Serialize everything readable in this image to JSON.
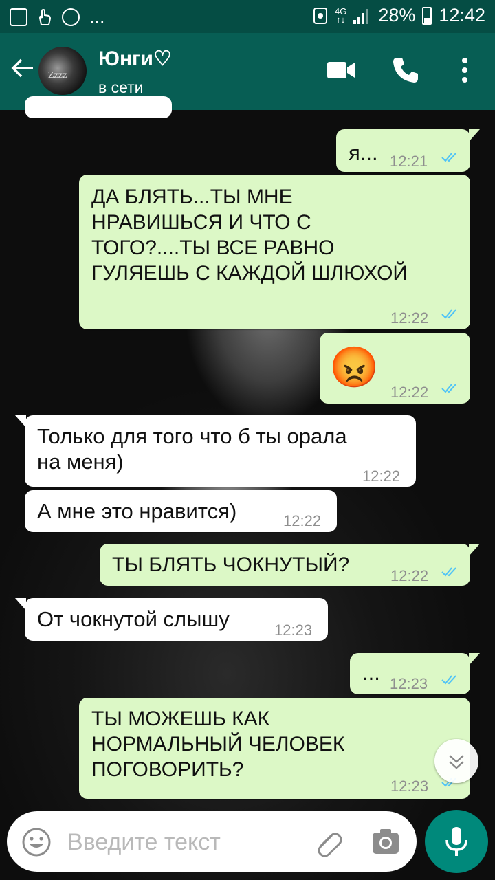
{
  "status_bar": {
    "dots": "...",
    "network": "4G",
    "battery": "28%",
    "time": "12:42"
  },
  "header": {
    "back_icon": "arrow-left-icon",
    "contact_name": "Юнги♡",
    "contact_status": "в сети",
    "avatar_text": "Zzzz"
  },
  "messages": [
    {
      "dir": "out",
      "text": "я...",
      "time": "12:21",
      "read": true
    },
    {
      "dir": "out",
      "text": "ДА БЛЯТЬ...ТЫ МНЕ\nНРАВИШЬСЯ И ЧТО С\nТОГО?....ТЫ ВСЕ РАВНО\nГУЛЯЕШЬ С КАЖДОЙ ШЛЮХОЙ",
      "time": "12:22",
      "read": true
    },
    {
      "dir": "out",
      "emoji": "😡",
      "time": "12:22",
      "read": true
    },
    {
      "dir": "in",
      "text": "Только для того что б ты орала\nна меня)",
      "time": "12:22"
    },
    {
      "dir": "in",
      "text": "А мне это нравится)",
      "time": "12:22"
    },
    {
      "dir": "out",
      "text": "ТЫ БЛЯТЬ ЧОКНУТЫЙ?",
      "time": "12:22",
      "read": true
    },
    {
      "dir": "in",
      "text": "От чокнутой слышу",
      "time": "12:23"
    },
    {
      "dir": "out",
      "text": "...",
      "time": "12:23",
      "read": true
    },
    {
      "dir": "out",
      "text": "ТЫ МОЖЕШЬ КАК\nНОРМАЛЬНЫЙ ЧЕЛОВЕК\nПОГОВОРИТЬ?",
      "time": "12:23",
      "read": true
    }
  ],
  "input": {
    "placeholder": "Введите текст"
  },
  "colors": {
    "header": "#075e54",
    "status_bar": "#054d44",
    "outgoing_bubble": "#dcf8c6",
    "incoming_bubble": "#ffffff",
    "read_ticks": "#4fc3f7",
    "mic_button": "#00897b"
  }
}
